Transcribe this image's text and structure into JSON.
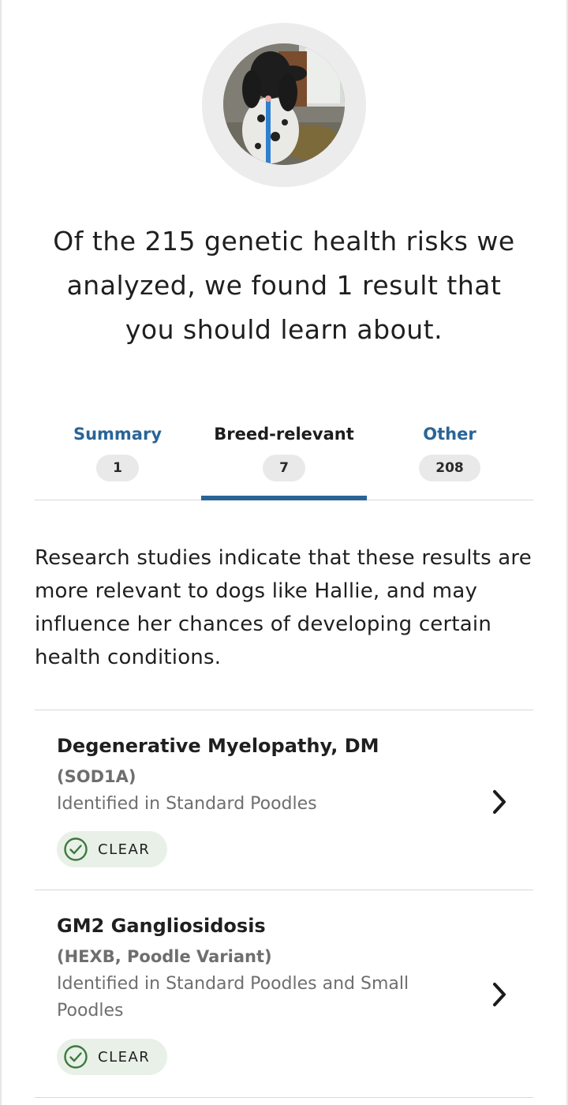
{
  "headline": "Of the 215 genetic health risks we analyzed, we found 1 result that you should learn about.",
  "tabs": [
    {
      "label": "Summary",
      "count": "1"
    },
    {
      "label": "Breed-relevant",
      "count": "7"
    },
    {
      "label": "Other",
      "count": "208"
    }
  ],
  "active_tab": "Breed-relevant",
  "description": "Research studies indicate that these results are more relevant to dogs like Hallie, and may influence her chances of developing certain health conditions.",
  "results": [
    {
      "title": "Degenerative Myelopathy, DM",
      "gene": "(SOD1A)",
      "identified": "Identified in Standard Poodles",
      "status": "CLEAR"
    },
    {
      "title": "GM2 Gangliosidosis",
      "gene": "(HEXB, Poodle Variant)",
      "identified": "Identified in Standard Poodles and Small Poodles",
      "status": "CLEAR"
    }
  ],
  "colors": {
    "accent": "#2a6497",
    "clear_bg": "#e8f0e8",
    "clear_check": "#3b7a3b"
  },
  "icons": {
    "chevron": "chevron-right-icon",
    "status": "check-circle-icon"
  }
}
